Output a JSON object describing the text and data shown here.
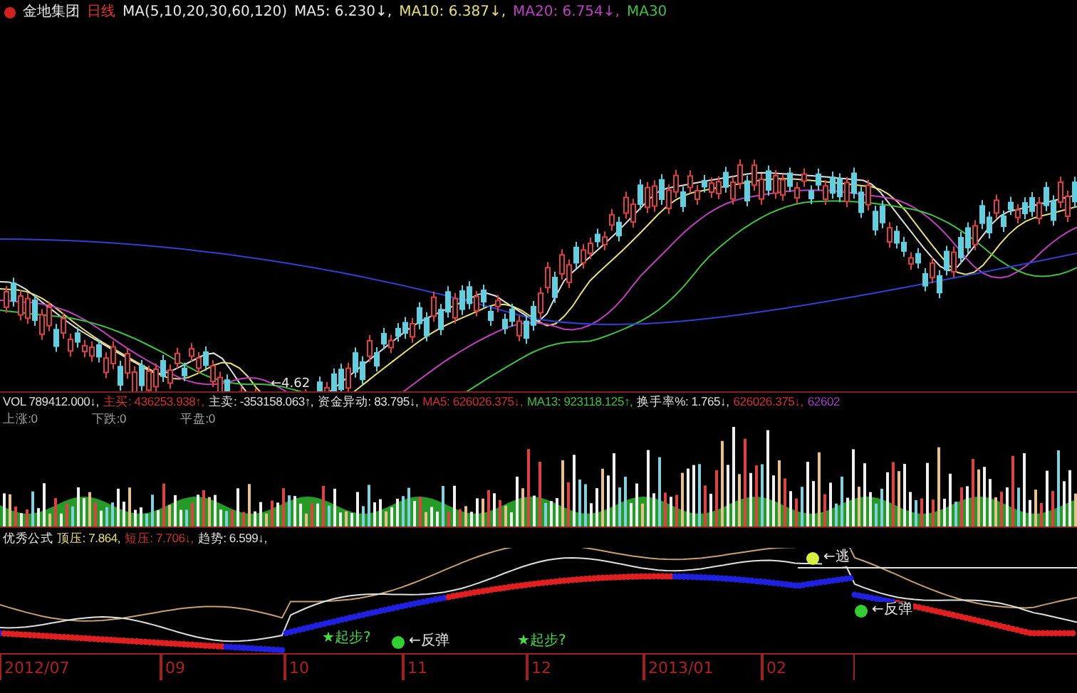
{
  "title_bar": {
    "stock_name": "金地集团",
    "period": "日线",
    "ma_params": "MA(5,10,20,30,60,120)",
    "values": [
      {
        "text": "MA5: 6.230↓,",
        "color": "#e8e8e8"
      },
      {
        "text": "MA10: 6.387↓,",
        "color": "#e8e070"
      },
      {
        "text": "MA20: 6.754↓,",
        "color": "#c040c0"
      },
      {
        "text": "MA30",
        "color": "#40c040"
      }
    ]
  },
  "price_chart": {
    "low_label": "←4.62"
  },
  "volume_panel": {
    "values": [
      {
        "text": "VOL 789412.000↓,",
        "color": "#e0e0e0"
      },
      {
        "text": "主买: 436253.938↑,",
        "color": "#d03030"
      },
      {
        "text": "主卖: -353158.063↑,",
        "color": "#e0e0e0"
      },
      {
        "text": "资金异动: 83.795↓,",
        "color": "#e0e0e0"
      },
      {
        "text": "MA5: 626026.375↓,",
        "color": "#d03030"
      },
      {
        "text": "MA13: 923118.125↑,",
        "color": "#40c040"
      },
      {
        "text": "换手率%: 1.765↓,",
        "color": "#e0e0e0"
      },
      {
        "text": "626026.375↓,",
        "color": "#d03030"
      },
      {
        "text": "62602",
        "color": "#a040c0"
      }
    ],
    "counts": [
      "上涨:0",
      "下跌:0",
      "平盘:0"
    ]
  },
  "indicator_panel": {
    "name": "优秀公式",
    "values": [
      {
        "text": "顶压: 7.864,",
        "color": "#e8e070"
      },
      {
        "text": "短压: 7.706↓,",
        "color": "#d03030"
      },
      {
        "text": "趋势: 6.599↓,",
        "color": "#e0e0e0"
      }
    ],
    "annotations": [
      {
        "kind": "dot",
        "text": "←逃",
        "color": "#d8f040"
      },
      {
        "kind": "dot",
        "text": "←反弹",
        "color": "#30d030"
      },
      {
        "kind": "dot",
        "text": "←反弹",
        "color": "#30d030"
      },
      {
        "kind": "star",
        "text": "★起步?"
      },
      {
        "kind": "star",
        "text": "★起步?"
      }
    ]
  },
  "date_axis": [
    "2012/07",
    "09",
    "10",
    "11",
    "12",
    "2013/01",
    "02"
  ]
}
